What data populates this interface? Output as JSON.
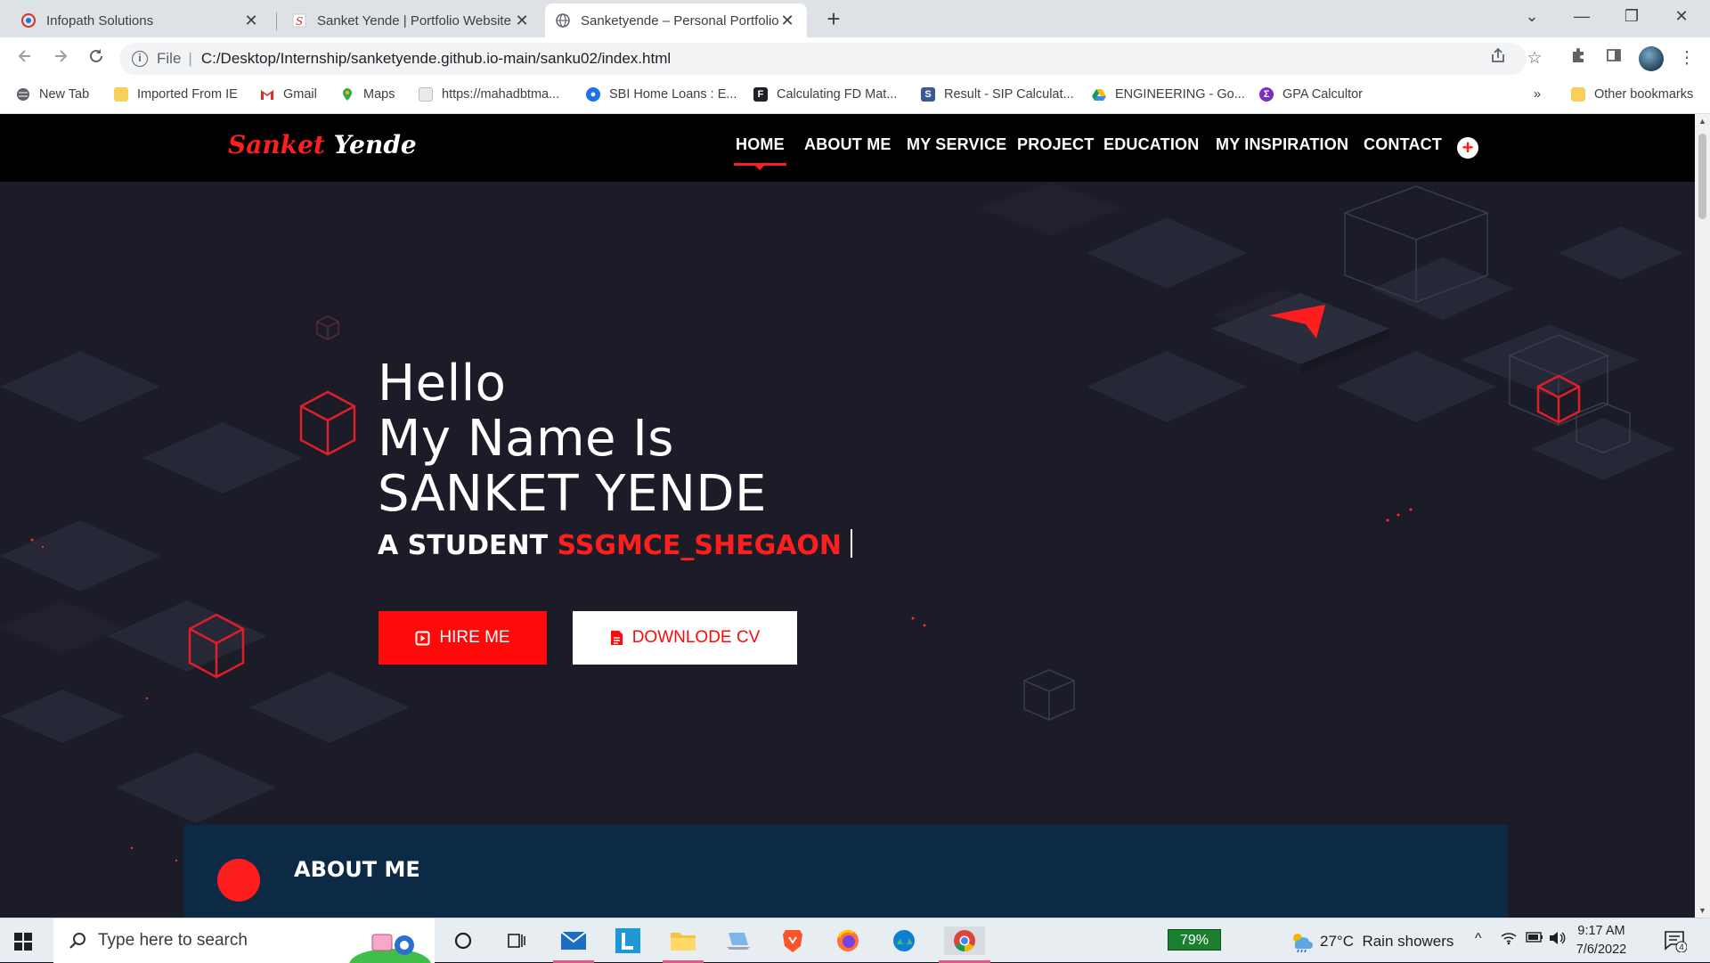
{
  "browser": {
    "tabs": [
      {
        "title": "Infopath Solutions",
        "close": "✕"
      },
      {
        "title": "Sanket Yende | Portfolio Website",
        "close": "✕"
      },
      {
        "title": "Sanketyende – Personal Portfolio",
        "close": "✕",
        "active": true
      }
    ],
    "new_tab": "+",
    "window_controls": {
      "dropdown": "⌄",
      "minimize": "—",
      "restore": "❐",
      "close": "✕"
    },
    "address": {
      "scheme_label": "File",
      "url": "C:/Desktop/Internship/sanketyende.github.io-main/sanku02/index.html"
    },
    "bookmarks": [
      "New Tab",
      "Imported From IE",
      "Gmail",
      "Maps",
      "https://mahadbtma...",
      "SBI Home Loans : E...",
      "Calculating FD Mat...",
      "Result - SIP Calculat...",
      "ENGINEERING - Go...",
      "GPA Calcultor"
    ],
    "bookmarks_overflow": "»",
    "other_bookmarks": "Other bookmarks"
  },
  "site": {
    "brand_first": "Sanket",
    "brand_last": "Yende",
    "nav": [
      "HOME",
      "ABOUT ME",
      "MY SERVICE",
      "PROJECT",
      "EDUCATION",
      "MY INSPIRATION",
      "CONTACT"
    ],
    "plus": "+",
    "hero": {
      "line1": "Hello",
      "line2": "My Name Is",
      "line3": "SANKET YENDE",
      "sub_prefix": "A STUDENT",
      "sub_highlight": "SSGMCE_SHEGAON",
      "hire_label": "HIRE ME",
      "cv_label": "DOWNLODE CV"
    },
    "about_title": "ABOUT ME",
    "accent_color": "#ff1e1e"
  },
  "taskbar": {
    "search_placeholder": "Type here to search",
    "battery": "79%",
    "weather_temp": "27°C",
    "weather_desc": "Rain showers",
    "time": "9:17 AM",
    "date": "7/6/2022",
    "notifications": "4"
  }
}
